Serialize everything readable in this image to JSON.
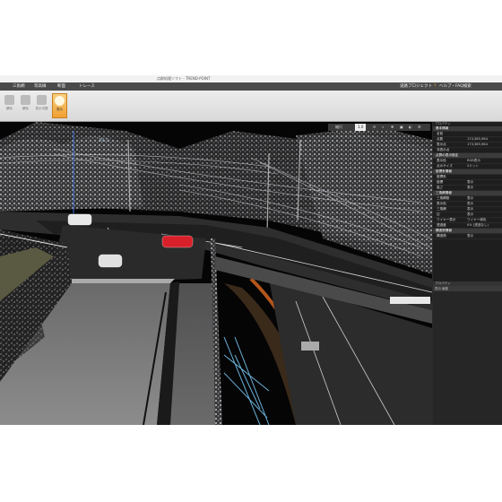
{
  "window": {
    "title": "点群処理ソフト - TREND-POINT"
  },
  "menu": {
    "items": [
      "三角網",
      "等高線",
      "断面",
      "トレース"
    ],
    "project": "道路プロジェクト",
    "help": "ヘルプ・FAQ検索"
  },
  "ribbon": {
    "buttons": [
      {
        "label": "解除"
      },
      {
        "label": "解除"
      },
      {
        "label": "表示切替"
      },
      {
        "label": "表示"
      }
    ]
  },
  "viewport": {
    "toolbar": {
      "label": "縮尺",
      "value": "1.0"
    },
    "height_label": "39.5"
  },
  "panel": {
    "title": "プロパティ",
    "rows": [
      {
        "type": "section",
        "label": "基本情報"
      },
      {
        "type": "row",
        "key": "名前",
        "value": ""
      },
      {
        "type": "row",
        "key": "点数",
        "value": "173,365,964"
      },
      {
        "type": "row",
        "key": "表示点",
        "value": "173,365,964"
      },
      {
        "type": "row",
        "key": "非表示点",
        "value": ""
      },
      {
        "type": "section",
        "label": "点群の表示設定"
      },
      {
        "type": "row",
        "key": "表示色",
        "value": "RGB表示"
      },
      {
        "type": "row",
        "key": "点のサイズ",
        "value": "2ドット"
      },
      {
        "type": "section",
        "label": "座標系情報"
      },
      {
        "type": "row",
        "key": "座標系",
        "value": ""
      },
      {
        "type": "row",
        "key": "座標",
        "value": "表示"
      },
      {
        "type": "row",
        "key": "高さ",
        "value": "表示"
      },
      {
        "type": "section",
        "label": "三角網情報"
      },
      {
        "type": "row",
        "key": "三角網数",
        "value": "表示"
      },
      {
        "type": "row",
        "key": "表示色",
        "value": "表示"
      },
      {
        "type": "row",
        "key": "三角網",
        "value": "表示"
      },
      {
        "type": "row",
        "key": "辺",
        "value": "表示"
      },
      {
        "type": "row",
        "key": "ワイヤー表示",
        "value": "ワイヤー緑色"
      },
      {
        "type": "row",
        "key": "透過度",
        "value": "0% (透過なし)"
      },
      {
        "type": "section",
        "label": "構造物情報"
      },
      {
        "type": "row",
        "key": "構造物",
        "value": "表示"
      }
    ]
  },
  "panel2": {
    "title": "プロパティ",
    "toolbar": "表示 編集"
  }
}
